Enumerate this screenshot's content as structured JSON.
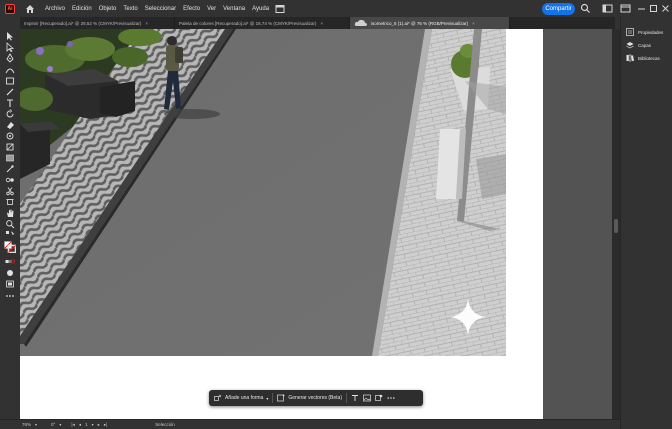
{
  "app": {
    "logo": "Ai"
  },
  "menu": {
    "items": [
      "Archivo",
      "Edición",
      "Objeto",
      "Texto",
      "Seleccionar",
      "Efecto",
      "Ver",
      "Ventana",
      "Ayuda"
    ],
    "share_label": "Compartir"
  },
  "tabs": [
    {
      "label": "Impimir [Recuperado].ai* @ 28,52 % (CMYK/Previsualizar)",
      "active": false
    },
    {
      "label": "Paleta de colores [Recuperado].ai* @ 16,74 % (CMYK/Previsualizar)",
      "active": false
    },
    {
      "label": "isometrico_5 (1).ai* @ 76 % (RGB/Previsualizar)",
      "active": true
    }
  ],
  "right_panel": {
    "items": [
      {
        "label": "Propiedades",
        "icon": "properties-icon"
      },
      {
        "label": "Capas",
        "icon": "layers-icon"
      },
      {
        "label": "Bibliotecas",
        "icon": "libraries-icon"
      }
    ]
  },
  "taskbar": {
    "add_shape_label": "Añade una forma",
    "generate_vectors_label": "Generar vectores (Beta)"
  },
  "status": {
    "zoom": "76%",
    "rotation": "0°",
    "artboard": "1",
    "mode": "Selección"
  },
  "colors": {
    "accent": "#1473e6",
    "ui_dark": "#323232",
    "road": "#6f6f6f",
    "sidewalk": "#c9c9c9"
  }
}
